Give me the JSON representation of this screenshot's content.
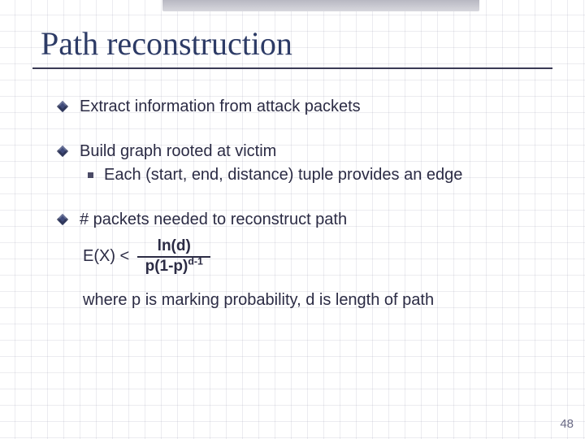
{
  "title": "Path reconstruction",
  "bullets": {
    "b1": "Extract information from attack packets",
    "b2": "Build graph rooted at victim",
    "b2_sub": "Each (start, end, distance) tuple provides an edge",
    "b3": "# packets needed to reconstruct path"
  },
  "formula": {
    "lhs": "E(X) <",
    "numerator": "ln(d)",
    "den_left": "p(1-p)",
    "den_exp": "d-1"
  },
  "where": "where p is marking probability, d is length of path",
  "page_number": "48"
}
